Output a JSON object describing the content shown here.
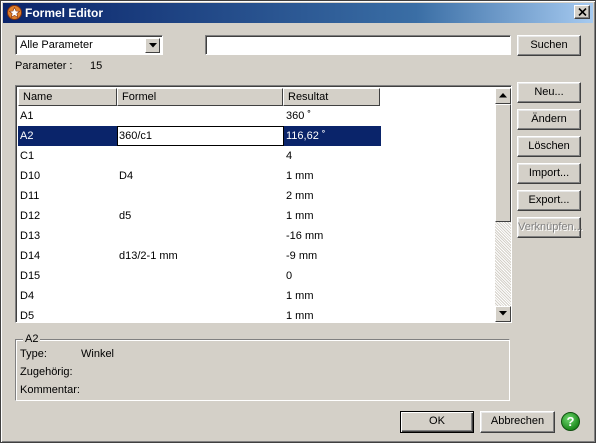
{
  "window": {
    "title": "Formel Editor"
  },
  "filter": {
    "selected": "Alle Parameter",
    "search_value": "",
    "search_button": "Suchen"
  },
  "count": {
    "label": "Parameter :",
    "value": "15"
  },
  "table": {
    "columns": [
      "Name",
      "Formel",
      "Resultat"
    ],
    "rows": [
      {
        "name": "A1",
        "formula": "",
        "result": "360 ˚"
      },
      {
        "name": "A2",
        "formula": "360/c1",
        "result": "116,62 ˚",
        "selected": true
      },
      {
        "name": "C1",
        "formula": "",
        "result": "4"
      },
      {
        "name": "D10",
        "formula": "D4",
        "result": "1 mm"
      },
      {
        "name": "D11",
        "formula": "",
        "result": "2 mm"
      },
      {
        "name": "D12",
        "formula": "d5",
        "result": "1 mm"
      },
      {
        "name": "D13",
        "formula": "",
        "result": "-16 mm"
      },
      {
        "name": "D14",
        "formula": "d13/2-1 mm",
        "result": "-9 mm"
      },
      {
        "name": "D15",
        "formula": "",
        "result": " 0"
      },
      {
        "name": "D4",
        "formula": "",
        "result": "1 mm"
      },
      {
        "name": "D5",
        "formula": "",
        "result": "1 mm"
      }
    ]
  },
  "side_buttons": {
    "new": "Neu...",
    "change": "Ändern",
    "delete": "Löschen",
    "import": "Import...",
    "export": "Export...",
    "link": "Verknüpfen..."
  },
  "details": {
    "title": "A2",
    "type_label": "Type:",
    "type_value": "Winkel",
    "belongs_label": "Zugehörig:",
    "comment_label": "Kommentar:"
  },
  "footer": {
    "ok": "OK",
    "cancel": "Abbrechen",
    "help": "?"
  }
}
